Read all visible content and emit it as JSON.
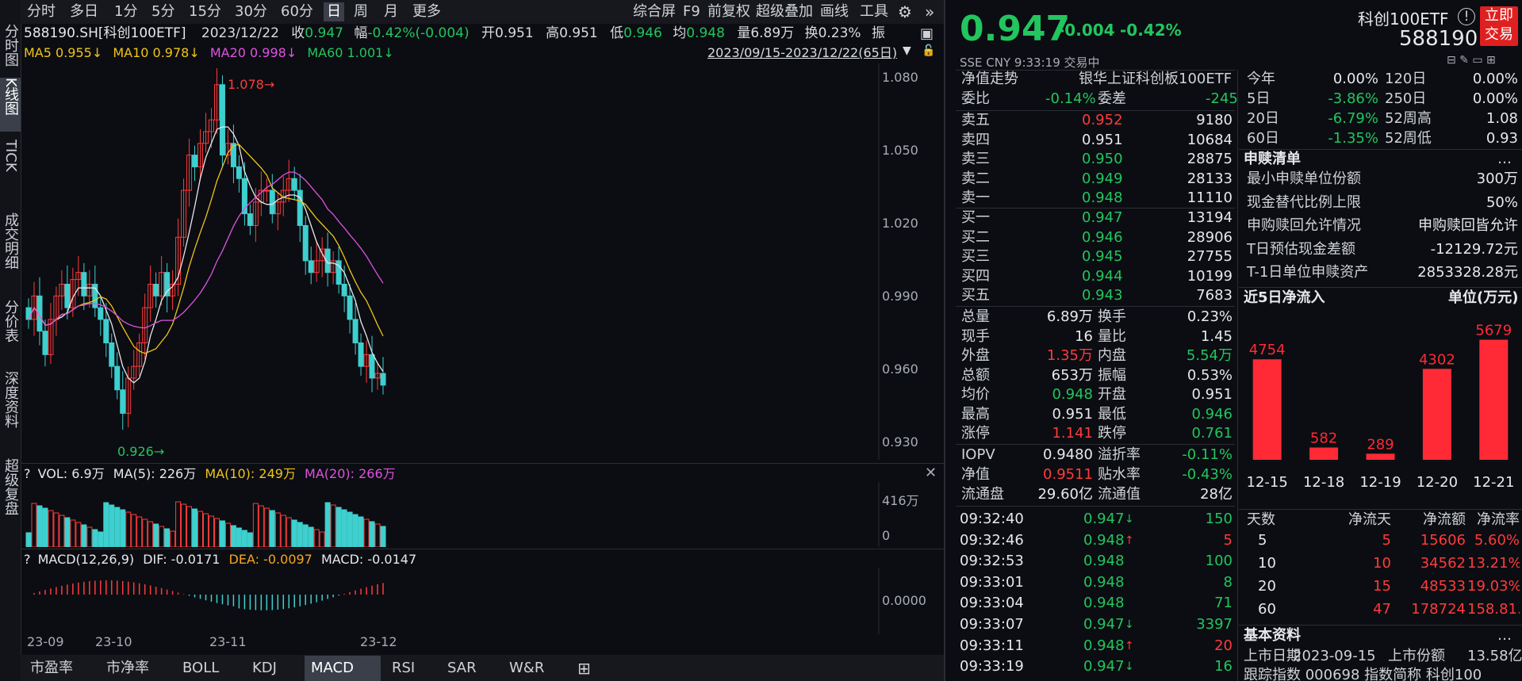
{
  "toolbar": {
    "periods": [
      "分时",
      "多日",
      "1分",
      "5分",
      "15分",
      "30分",
      "60分",
      "日",
      "周",
      "月",
      "更多"
    ],
    "active_period": "日",
    "right_items": [
      "综合屏",
      "F9",
      "前复权",
      "超级叠加",
      "画线",
      "工具"
    ]
  },
  "left_nav": [
    "分时图",
    "K线图",
    "TICK",
    "成交明细",
    "分价表",
    "深度资料",
    "超级复盘"
  ],
  "info_line": {
    "code": "588190.SH[科创100ETF]",
    "date": "2023/12/22",
    "close_label": "收",
    "close": "0.947",
    "change_label": "幅",
    "change": "-0.42%(-0.004)",
    "open_label": "开",
    "open": "0.951",
    "high_label": "高",
    "high": "0.951",
    "low_label": "低",
    "low": "0.946",
    "avg_label": "均",
    "avg": "0.948",
    "vol_label": "量",
    "vol": "6.89万",
    "turn_label": "换",
    "turn": "0.23%",
    "amp_label": "振"
  },
  "ma_line": {
    "ma5": "MA5 0.955↓",
    "ma10": "MA10 0.978↓",
    "ma20": "MA20 0.998↓",
    "ma60": "MA60 1.001↓",
    "range": "2023/09/15-2023/12/22(65日)"
  },
  "kline": {
    "y_ticks": [
      "1.080",
      "1.050",
      "1.020",
      "0.990",
      "0.960",
      "0.930"
    ],
    "high_mark": "1.078",
    "low_mark": "0.926",
    "x_ticks": [
      "23-09",
      "23-10",
      "23-11",
      "23-12"
    ]
  },
  "vol_panel": {
    "title": "VOL: 6.9万",
    "ma5": "MA(5): 226万",
    "ma10": "MA(10): 249万",
    "ma20": "MA(20): 266万",
    "y_ticks": [
      "416万",
      "0"
    ]
  },
  "macd_panel": {
    "title": "MACD(12,26,9)",
    "dif": "DIF: -0.0171",
    "dea": "DEA: -0.0097",
    "macd": "MACD: -0.0147",
    "y_tick": "0.0000"
  },
  "bottom_tabs": [
    "市盈率",
    "市净率",
    "BOLL",
    "KDJ",
    "MACD",
    "RSI",
    "SAR",
    "W&R"
  ],
  "active_tab": "MACD",
  "quote": {
    "price": "0.947",
    "change": "-0.004",
    "pct": "-0.42%",
    "name": "科创100ETF",
    "code": "588190",
    "exchange": "SSE  CNY  9:33:19  交易中",
    "trade_btn": "立即交易",
    "nav_label": "净值走势",
    "fund_name": "银华上证科创板100ETF",
    "wb_label": "委比",
    "wb": "-0.14%",
    "wc_label": "委差",
    "wc": "-245"
  },
  "asks": [
    {
      "label": "卖五",
      "price": "0.952",
      "vol": "9180"
    },
    {
      "label": "卖四",
      "price": "0.951",
      "vol": "10684"
    },
    {
      "label": "卖三",
      "price": "0.950",
      "vol": "28875"
    },
    {
      "label": "卖二",
      "price": "0.949",
      "vol": "28133"
    },
    {
      "label": "卖一",
      "price": "0.948",
      "vol": "11110"
    }
  ],
  "bids": [
    {
      "label": "买一",
      "price": "0.947",
      "vol": "13194"
    },
    {
      "label": "买二",
      "price": "0.946",
      "vol": "28906"
    },
    {
      "label": "买三",
      "price": "0.945",
      "vol": "27755"
    },
    {
      "label": "买四",
      "price": "0.944",
      "vol": "10199"
    },
    {
      "label": "买五",
      "price": "0.943",
      "vol": "7683"
    }
  ],
  "stats": [
    {
      "l1": "总量",
      "v1": "6.89万",
      "l2": "换手",
      "v2": "0.23%"
    },
    {
      "l1": "现手",
      "v1": "16",
      "l2": "量比",
      "v2": "1.45"
    },
    {
      "l1": "外盘",
      "v1": "1.35万",
      "l2": "内盘",
      "v2": "5.54万"
    },
    {
      "l1": "总额",
      "v1": "653万",
      "l2": "振幅",
      "v2": "0.53%"
    },
    {
      "l1": "均价",
      "v1": "0.948",
      "l2": "开盘",
      "v2": "0.951"
    },
    {
      "l1": "最高",
      "v1": "0.951",
      "l2": "最低",
      "v2": "0.946"
    },
    {
      "l1": "涨停",
      "v1": "1.141",
      "l2": "跌停",
      "v2": "0.761"
    }
  ],
  "iopv": [
    {
      "l1": "IOPV",
      "v1": "0.9480",
      "l2": "溢折率",
      "v2": "-0.11%"
    },
    {
      "l1": "净值",
      "v1": "0.9511",
      "l2": "贴水率",
      "v2": "-0.43%"
    },
    {
      "l1": "流通盘",
      "v1": "29.60亿",
      "l2": "流通值",
      "v2": "28亿"
    }
  ],
  "ticks": [
    {
      "time": "09:32:40",
      "price": "0.947",
      "dir": "↓",
      "vol": "150"
    },
    {
      "time": "09:32:46",
      "price": "0.948",
      "dir": "↑",
      "vol": "5"
    },
    {
      "time": "09:32:53",
      "price": "0.948",
      "dir": "",
      "vol": "100"
    },
    {
      "time": "09:33:01",
      "price": "0.948",
      "dir": "",
      "vol": "8"
    },
    {
      "time": "09:33:04",
      "price": "0.948",
      "dir": "",
      "vol": "71"
    },
    {
      "time": "09:33:07",
      "price": "0.947",
      "dir": "↓",
      "vol": "3397"
    },
    {
      "time": "09:33:11",
      "price": "0.948",
      "dir": "↑",
      "vol": "20"
    },
    {
      "time": "09:33:19",
      "price": "0.947",
      "dir": "↓",
      "vol": "16"
    }
  ],
  "perf": [
    {
      "l1": "今年",
      "v1": "0.00%",
      "l2": "120日",
      "v2": "0.00%"
    },
    {
      "l1": "5日",
      "v1": "-3.86%",
      "l2": "250日",
      "v2": "0.00%"
    },
    {
      "l1": "20日",
      "v1": "-6.79%",
      "l2": "52周高",
      "v2": "1.08"
    },
    {
      "l1": "60日",
      "v1": "-1.35%",
      "l2": "52周低",
      "v2": "0.93"
    }
  ],
  "subscribe": {
    "title": "申赎清单",
    "rows": [
      {
        "l": "最小申赎单位份额",
        "v": "300万"
      },
      {
        "l": "现金替代比例上限",
        "v": "50%"
      },
      {
        "l": "申购赎回允许情况",
        "v": "申购赎回皆允许"
      },
      {
        "l": "T日预估现金差额",
        "v": "-12129.72元"
      },
      {
        "l": "T-1日单位申赎资产",
        "v": "2853328.28元"
      }
    ]
  },
  "inflow": {
    "title": "近5日净流入",
    "unit": "单位(万元)",
    "table_header": [
      "天数",
      "净流天",
      "净流额",
      "净流率"
    ],
    "table": [
      {
        "d": "5",
        "n": "5",
        "a": "15606",
        "r": "5.60%"
      },
      {
        "d": "10",
        "n": "10",
        "a": "34562",
        "r": "13.21%"
      },
      {
        "d": "20",
        "n": "15",
        "a": "48533",
        "r": "19.03%"
      },
      {
        "d": "60",
        "n": "47",
        "a": "178724",
        "r": "158.81..."
      }
    ]
  },
  "basic": {
    "title": "基本资料",
    "row1_l": "上市日期",
    "row1_v": "2023-09-15",
    "row1_l2": "上市份额",
    "row1_v2": "13.58亿",
    "row2": "跟踪指数    000698  指数简称    科创100"
  },
  "chart_data": [
    {
      "type": "bar",
      "title": "近5日净流入",
      "ylabel": "单位(万元)",
      "categories": [
        "12-15",
        "12-18",
        "12-19",
        "12-20",
        "12-21"
      ],
      "values": [
        4754,
        582,
        289,
        4302,
        5679
      ],
      "ylim": [
        0,
        6000
      ],
      "bar_color": "#ff2a35"
    },
    {
      "type": "line",
      "title": "588190.SH[科创100ETF]",
      "x": [
        "23-09",
        "23-10",
        "23-11",
        "23-12"
      ],
      "ylim": [
        0.926,
        1.08
      ],
      "series": [
        {
          "name": "MA5",
          "values": [
            0.955
          ]
        },
        {
          "name": "MA10",
          "values": [
            0.978
          ]
        },
        {
          "name": "MA20",
          "values": [
            0.998
          ]
        },
        {
          "name": "MA60",
          "values": [
            1.001
          ]
        }
      ]
    }
  ],
  "colors": {
    "up": "#ff3b3b",
    "down": "#22c55e",
    "candle_down": "#3ecfcf",
    "ma5": "#e6e8eb",
    "ma10": "#f0c419",
    "ma20": "#e052e0",
    "ma60": "#22c55e"
  }
}
